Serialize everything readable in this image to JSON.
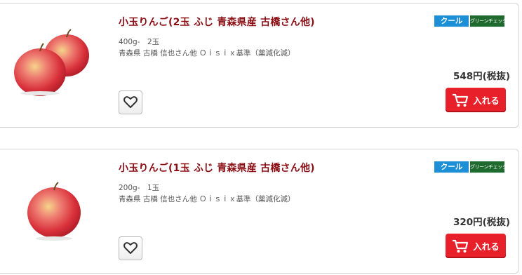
{
  "products": [
    {
      "title": "小玉りんご(2玉 ふじ 青森県産 古橋さん他)",
      "weight": "400g-　2玉",
      "producer": "青森県 古橋 信也さん他 Ｏｉｓｉｘ基準（薬減化減）",
      "tag_cool": "クール",
      "tag_green": "グリーンチェック",
      "price": "548円(税抜)",
      "cart_label": "入れる",
      "apple_count": 2
    },
    {
      "title": "小玉りんご(1玉 ふじ 青森県産 古橋さん他)",
      "weight": "200g-　1玉",
      "producer": "青森県 古橋 信也さん他 Ｏｉｓｉｘ基準（薬減化減）",
      "tag_cool": "クール",
      "tag_green": "グリーンチェック",
      "price": "320円(税抜)",
      "cart_label": "入れる",
      "apple_count": 1
    }
  ],
  "icons": {
    "favorite": "heart-icon",
    "cart": "cart-icon"
  },
  "colors": {
    "title": "#8b0d14",
    "cart_button": "#e8202a",
    "tag_cool": "#1d8fd6",
    "tag_green": "#1f6a2f"
  }
}
